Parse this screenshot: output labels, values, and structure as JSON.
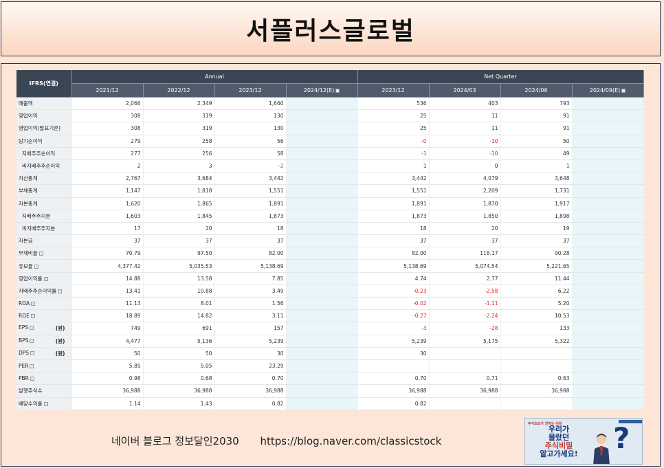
{
  "title": "서플러스글로벌",
  "table": {
    "corner": "IFRS(연결)",
    "group_annual": "Annual",
    "group_quarter": "Net Quarter",
    "columns": [
      {
        "label": "2021/12",
        "est": false
      },
      {
        "label": "2022/12",
        "est": false
      },
      {
        "label": "2023/12",
        "est": false
      },
      {
        "label": "2024/12(E)",
        "est": true
      },
      {
        "label": "2023/12",
        "est": false
      },
      {
        "label": "2024/03",
        "est": false
      },
      {
        "label": "2024/06",
        "est": false
      },
      {
        "label": "2024/09(E)",
        "est": true
      }
    ],
    "rows": [
      {
        "label": "매출액",
        "values": [
          "2,066",
          "2,349",
          "1,660",
          "",
          "536",
          "403",
          "793",
          ""
        ]
      },
      {
        "label": "영업이익",
        "values": [
          "308",
          "319",
          "130",
          "",
          "25",
          "11",
          "91",
          ""
        ]
      },
      {
        "label": "영업이익(발표기준)",
        "values": [
          "308",
          "319",
          "130",
          "",
          "25",
          "11",
          "91",
          ""
        ]
      },
      {
        "label": "당기순이익",
        "values": [
          "279",
          "258",
          "56",
          "",
          "-0",
          "-10",
          "50",
          ""
        ]
      },
      {
        "label": "지배주주순이익",
        "sub": true,
        "values": [
          "277",
          "256",
          "58",
          "",
          "-1",
          "-10",
          "49",
          ""
        ]
      },
      {
        "label": "비지배주주순이익",
        "sub": true,
        "values": [
          "2",
          "3",
          "-2",
          "",
          "1",
          "0",
          "1",
          ""
        ]
      },
      {
        "label": "자산총계",
        "values": [
          "2,767",
          "3,684",
          "3,442",
          "",
          "3,442",
          "4,079",
          "3,648",
          ""
        ]
      },
      {
        "label": "부채총계",
        "values": [
          "1,147",
          "1,818",
          "1,551",
          "",
          "1,551",
          "2,209",
          "1,731",
          ""
        ]
      },
      {
        "label": "자본총계",
        "values": [
          "1,620",
          "1,865",
          "1,891",
          "",
          "1,891",
          "1,870",
          "1,917",
          ""
        ]
      },
      {
        "label": "지배주주지분",
        "sub": true,
        "values": [
          "1,603",
          "1,845",
          "1,873",
          "",
          "1,873",
          "1,850",
          "1,898",
          ""
        ]
      },
      {
        "label": "비지배주주지분",
        "sub": true,
        "values": [
          "17",
          "20",
          "18",
          "",
          "18",
          "20",
          "19",
          ""
        ]
      },
      {
        "label": "자본금",
        "values": [
          "37",
          "37",
          "37",
          "",
          "37",
          "37",
          "37",
          ""
        ]
      },
      {
        "label": "부채비율",
        "icon": true,
        "values": [
          "70.79",
          "97.50",
          "82.00",
          "",
          "82.00",
          "118.17",
          "90.28",
          ""
        ]
      },
      {
        "label": "유보율",
        "icon": true,
        "values": [
          "4,377.42",
          "5,035.53",
          "5,138.69",
          "",
          "5,138.69",
          "5,074.54",
          "5,221.65",
          ""
        ]
      },
      {
        "label": "영업이익률",
        "icon": true,
        "values": [
          "14.88",
          "13.58",
          "7.85",
          "",
          "4.74",
          "2.77",
          "11.44",
          ""
        ]
      },
      {
        "label": "지배주주순이익률",
        "icon": true,
        "values": [
          "13.41",
          "10.88",
          "3.49",
          "",
          "-0.23",
          "-2.58",
          "6.22",
          ""
        ]
      },
      {
        "label": "ROA",
        "icon": true,
        "values": [
          "11.13",
          "8.01",
          "1.56",
          "",
          "-0.02",
          "-1.11",
          "5.20",
          ""
        ]
      },
      {
        "label": "ROE",
        "icon": true,
        "values": [
          "18.89",
          "14.82",
          "3.11",
          "",
          "-0.27",
          "-2.24",
          "10.53",
          ""
        ]
      },
      {
        "label": "EPS",
        "icon": true,
        "unit": "(원)",
        "values": [
          "749",
          "691",
          "157",
          "",
          "-3",
          "-28",
          "133",
          ""
        ]
      },
      {
        "label": "BPS",
        "icon": true,
        "unit": "(원)",
        "values": [
          "4,477",
          "5,136",
          "5,239",
          "",
          "5,239",
          "5,175",
          "5,322",
          ""
        ]
      },
      {
        "label": "DPS",
        "icon": true,
        "unit": "(원)",
        "values": [
          "50",
          "50",
          "30",
          "",
          "30",
          "",
          "",
          ""
        ]
      },
      {
        "label": "PER",
        "icon": true,
        "values": [
          "5.85",
          "5.05",
          "23.29",
          "",
          "",
          "",
          "",
          ""
        ]
      },
      {
        "label": "PBR",
        "icon": true,
        "values": [
          "0.98",
          "0.68",
          "0.70",
          "",
          "0.70",
          "0.71",
          "0.63",
          ""
        ]
      },
      {
        "label": "발행주식수",
        "values": [
          "36,988",
          "36,988",
          "36,988",
          "",
          "36,988",
          "36,988",
          "36,988",
          ""
        ]
      },
      {
        "label": "배당수익률",
        "icon": true,
        "values": [
          "1.14",
          "1.43",
          "0.82",
          "",
          "0.82",
          "",
          "",
          ""
        ]
      }
    ]
  },
  "footer": {
    "blog_name": "네이버 블로그 정보달인2030",
    "url": "https://blog.naver.com/classicstock"
  },
  "thumbnail": {
    "caption": "주식초보가 망하는 이유",
    "line1": "우리가",
    "line2": "몰랐던",
    "line3": "주식비밀",
    "line4": "알고가세요!"
  }
}
